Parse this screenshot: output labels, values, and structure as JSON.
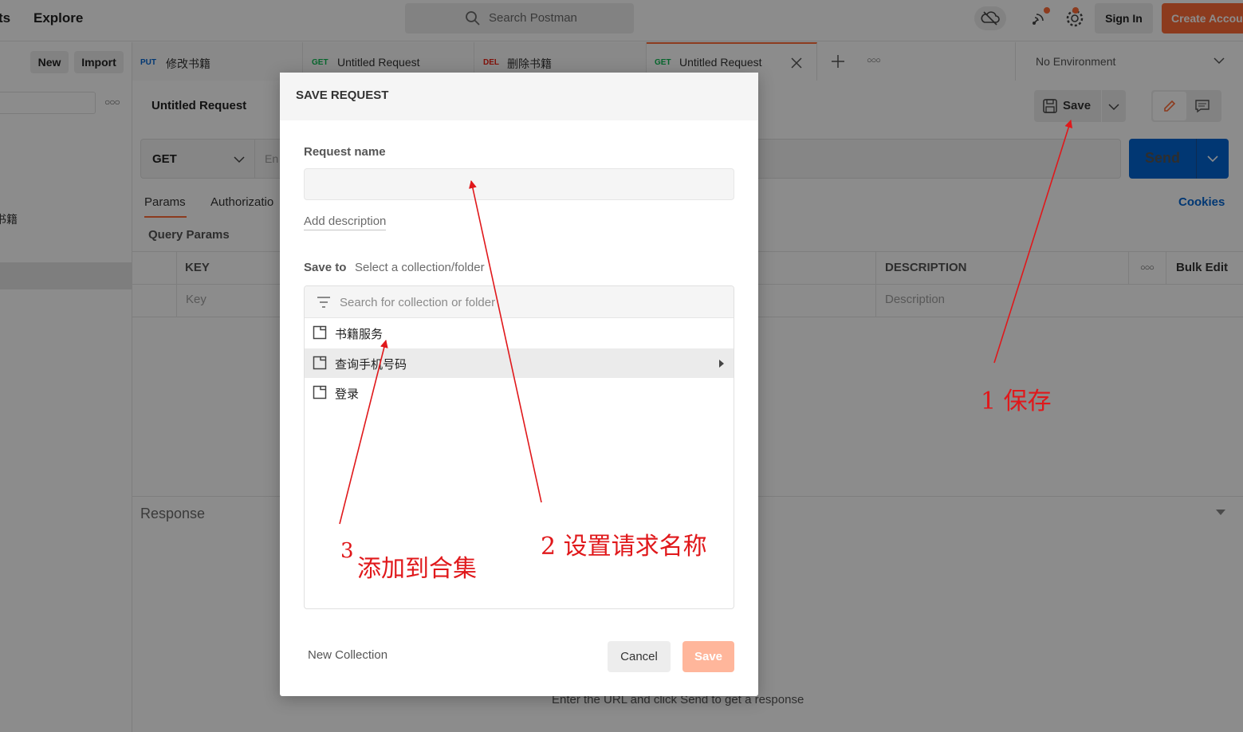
{
  "header": {
    "nav_cut": "ts",
    "explore": "Explore",
    "search_placeholder": "Search Postman",
    "sign_in": "Sign In",
    "create_account": "Create Account",
    "icons": [
      "cloud-offline-icon",
      "satellite-icon",
      "settings-icon"
    ]
  },
  "sidebar": {
    "new_label": "New",
    "import_label": "Import",
    "item_cut": "书籍"
  },
  "tabs": [
    {
      "method": "PUT",
      "title": "修改书籍",
      "method_color": "#0265d2"
    },
    {
      "method": "GET",
      "title": "Untitled Request",
      "method_color": "#0cbb52"
    },
    {
      "method": "DEL",
      "title": "删除书籍",
      "method_color": "#eb2013"
    },
    {
      "method": "GET",
      "title": "Untitled Request",
      "method_color": "#0cbb52",
      "active": true
    }
  ],
  "environment": "No Environment",
  "request": {
    "title": "Untitled Request",
    "save_label": "Save",
    "method": "GET",
    "url_placeholder_cut": "En",
    "send_label": "Send",
    "params_tabs": [
      "Params",
      "Authorizatio"
    ],
    "cookies": "Cookies",
    "query_params": "Query Params",
    "columns": {
      "key": "KEY",
      "description": "DESCRIPTION",
      "bulk_edit": "Bulk Edit"
    },
    "row_placeholders": {
      "key": "Key",
      "description": "Description"
    },
    "response_label": "Response",
    "response_hint": "Enter the URL and click Send to get a response"
  },
  "modal": {
    "title": "SAVE REQUEST",
    "request_name_label": "Request name",
    "request_name_value": "",
    "add_description": "Add description",
    "save_to_label": "Save to",
    "save_to_hint": "Select a collection/folder",
    "collection_search_placeholder": "Search for collection or folder",
    "collections": [
      {
        "name": "书籍服务",
        "highlighted": false,
        "has_children": false
      },
      {
        "name": "查询手机号码",
        "highlighted": true,
        "has_children": true
      },
      {
        "name": "登录",
        "highlighted": false,
        "has_children": false
      }
    ],
    "new_collection": "New Collection",
    "cancel_label": "Cancel",
    "save_label": "Save"
  },
  "annotations": {
    "step1": "1 保存",
    "step2": "2 设置请求名称",
    "step3_num": "3",
    "step3_text": "添加到合集",
    "color": "#e0181b"
  },
  "colors": {
    "accent": "#ff6c37",
    "send_blue": "#0265d2",
    "save_disabled": "#ffb69b"
  }
}
